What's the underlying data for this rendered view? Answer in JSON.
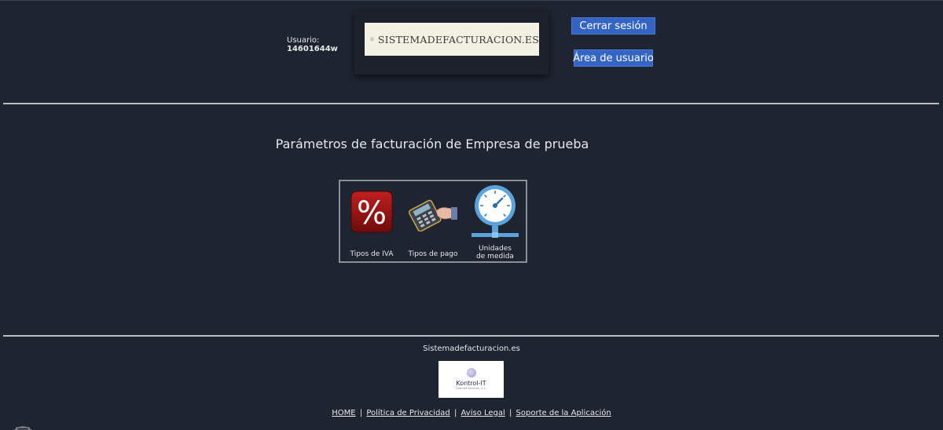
{
  "header": {
    "user_label": "Usuario:",
    "user_id": "14601644w",
    "logo_text": "SISTEMADEFACTURACION.ES",
    "logout_label": "Cerrar sesión",
    "user_area_label": "Área de usuario"
  },
  "main": {
    "title": "Parámetros de facturación de Empresa de prueba",
    "tiles": [
      {
        "label": "Tipos de IVA",
        "icon": "percent-icon"
      },
      {
        "label": "Tipos de pago",
        "icon": "card-terminal-icon"
      },
      {
        "label_line1": "Unidades",
        "label_line2": "de medida",
        "icon": "gauge-icon"
      }
    ]
  },
  "footer": {
    "site_name": "Sistemadefacturacion.es",
    "partner_name": "Kontrol-IT",
    "partner_sub": "Internet Services, S.L.",
    "links": [
      "HOME",
      "Política de Privacidad",
      "Aviso Legal",
      "Soporte de la Aplicación"
    ],
    "separator": "|"
  },
  "colors": {
    "background": "#1e2430",
    "button": "#3565c4",
    "logo_banner": "#f3f1e2"
  }
}
